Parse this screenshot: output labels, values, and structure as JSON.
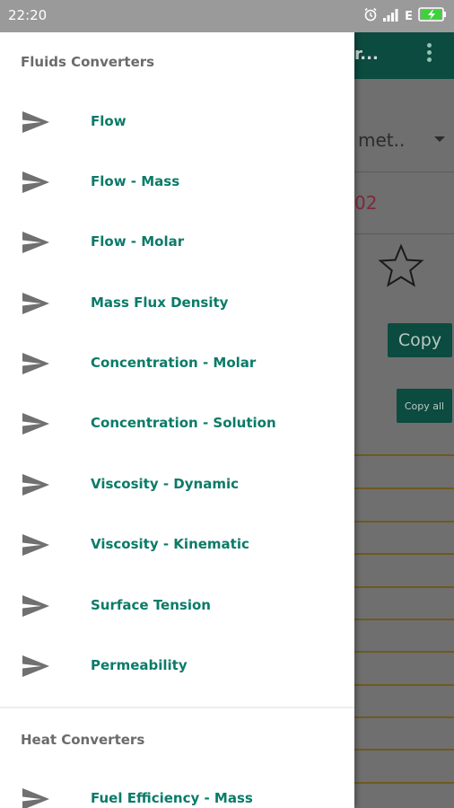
{
  "status_bar": {
    "time": "22:20",
    "network": "E",
    "icons": [
      "alarm-icon",
      "signal-icon",
      "battery-charging-icon"
    ]
  },
  "background_app": {
    "toolbar_title": "r...",
    "unit_text": "met..",
    "value_text": "02",
    "copy_label": "Copy",
    "copy_all_label": "Copy all",
    "colors": {
      "toolbar": "#0c4b3f",
      "value": "#7d2a3c"
    }
  },
  "drawer": {
    "sections": [
      {
        "header": "Fluids Converters",
        "items": [
          "Flow",
          "Flow - Mass",
          "Flow - Molar",
          "Mass Flux Density",
          "Concentration - Molar",
          "Concentration - Solution",
          "Viscosity - Dynamic",
          "Viscosity - Kinematic",
          "Surface Tension",
          "Permeability"
        ]
      },
      {
        "header": "Heat Converters",
        "items": [
          "Fuel Efficiency - Mass"
        ]
      }
    ],
    "colors": {
      "item_text": "#0a7b68",
      "header_text": "#6b6b6b",
      "icon": "#707070"
    }
  }
}
